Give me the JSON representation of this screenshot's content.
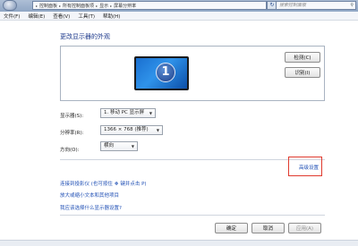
{
  "address_bar": {
    "segments": [
      "控制面板",
      "所有控制面板项",
      "显示",
      "屏幕分辨率"
    ]
  },
  "search": {
    "placeholder": "搜索控制面板"
  },
  "menu": {
    "items": [
      "文件(F)",
      "编辑(E)",
      "查看(V)",
      "工具(T)",
      "帮助(H)"
    ]
  },
  "main": {
    "title": "更改显示器的外观",
    "monitor_number": "1",
    "detect_label": "检测(C)",
    "identify_label": "识别(I)"
  },
  "settings": {
    "display_label": "显示器(S):",
    "display_value": "1. 移动 PC 显示屏",
    "resolution_label": "分辨率(R):",
    "resolution_value": "1366 × 768 (推荐)",
    "orientation_label": "方向(O):",
    "orientation_value": "横向"
  },
  "links": {
    "advanced": "高级设置",
    "projector": "连接到投影仪 (也可按住 ❖ 键并点击 P)",
    "text_size": "放大或缩小文本和其他项目",
    "help": "我应该选择什么显示器设置?"
  },
  "buttons": {
    "ok": "确定",
    "cancel": "取消",
    "apply": "应用(A)"
  },
  "colors": {
    "link": "#1f4fb5",
    "title": "#1e3a8c",
    "highlight": "#e03a2e",
    "monitor": "#2f93ea"
  }
}
